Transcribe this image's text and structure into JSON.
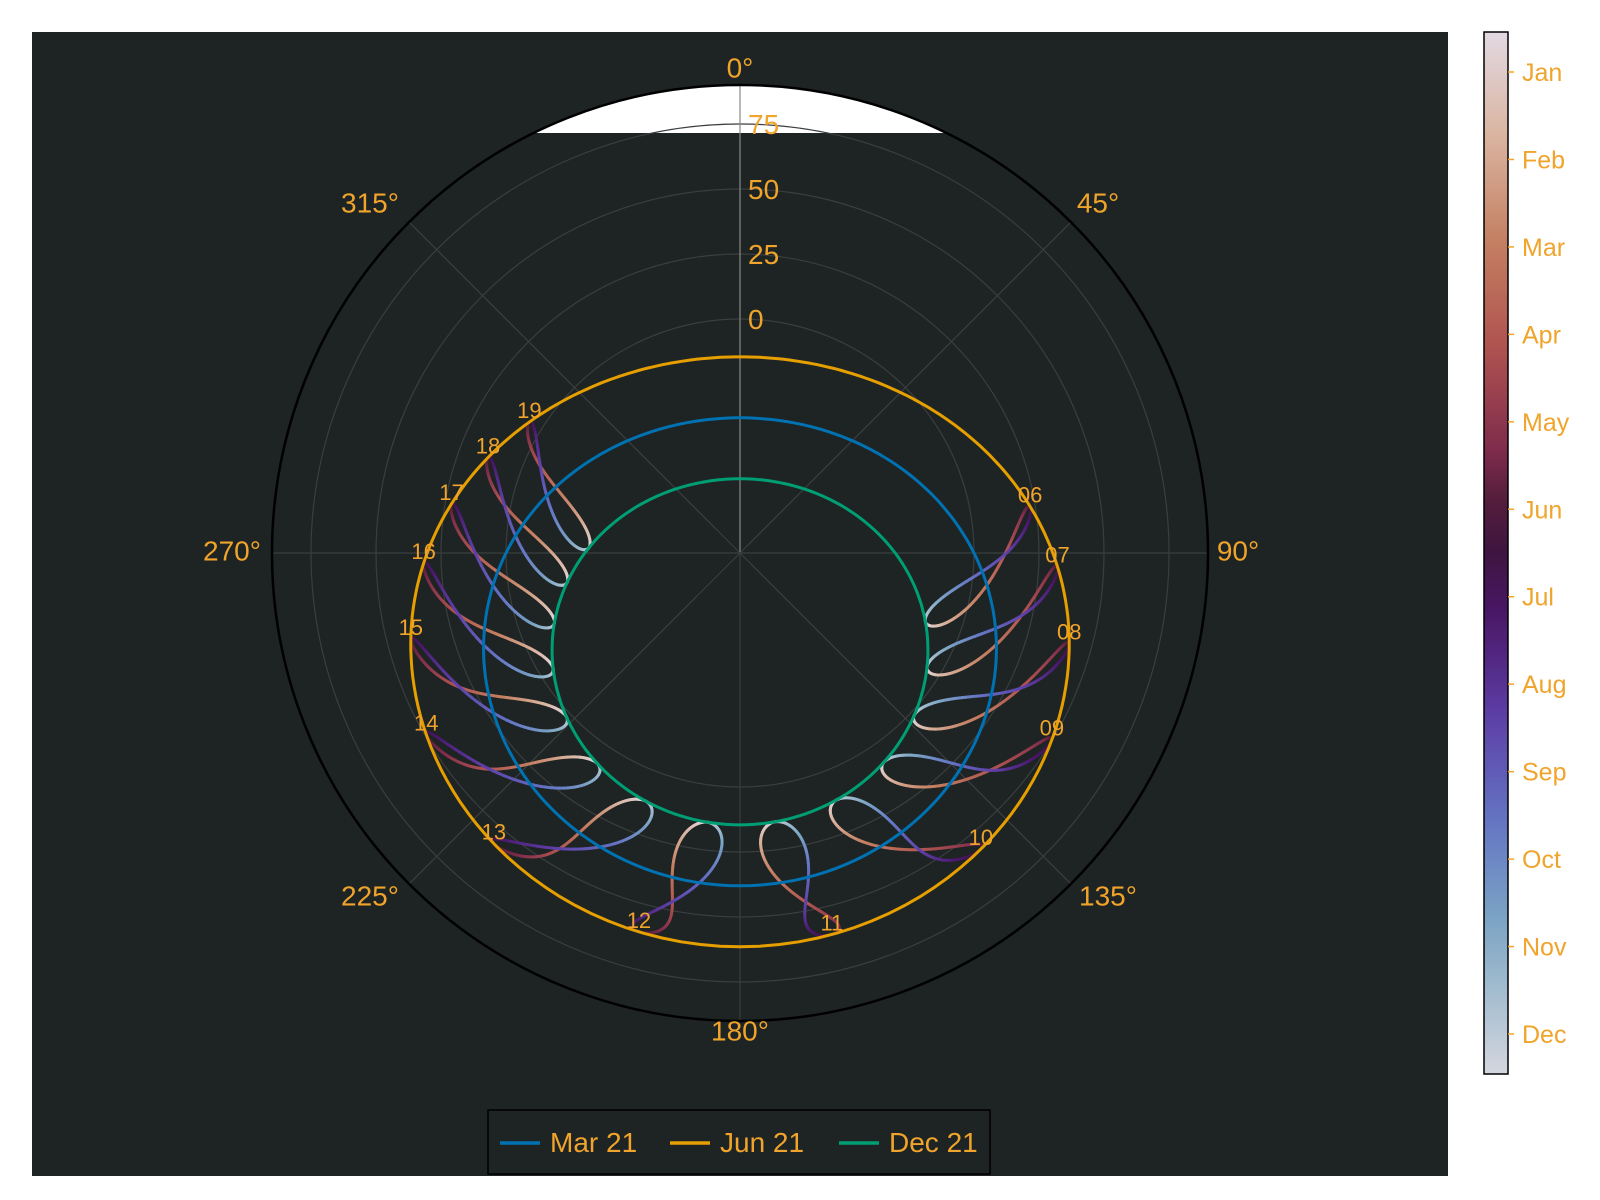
{
  "colors": {
    "background": "#1e2324",
    "text": "#f0a42b",
    "grid": "#3a3e3f",
    "frame": "#000000",
    "mar21": "#0072b2",
    "jun21": "#e69f00",
    "dec21": "#009e73"
  },
  "chart_data": {
    "type": "line",
    "projection": "polar",
    "theta_ticks": [
      "0°",
      "45°",
      "90°",
      "135°",
      "180°",
      "225°",
      "270°",
      "315°"
    ],
    "r_ticks": [
      "0",
      "25",
      "50",
      "75"
    ],
    "rlim": [
      -90,
      90
    ],
    "series": [
      {
        "name": "Mar 21",
        "color": "#0072b2",
        "declination": 0
      },
      {
        "name": "Jun 21",
        "color": "#e69f00",
        "declination": 23.44
      },
      {
        "name": "Dec 21",
        "color": "#009e73",
        "declination": -23.44
      }
    ],
    "analemma_hours": [
      "06",
      "07",
      "08",
      "09",
      "10",
      "11",
      "12",
      "13",
      "14",
      "15",
      "16",
      "17",
      "18",
      "19"
    ],
    "colorbar": {
      "ticks": [
        "Jan",
        "Feb",
        "Mar",
        "Apr",
        "May",
        "Jun",
        "Jul",
        "Aug",
        "Sep",
        "Oct",
        "Nov",
        "Dec"
      ]
    },
    "legend": {
      "placement": "bottom-center"
    }
  }
}
